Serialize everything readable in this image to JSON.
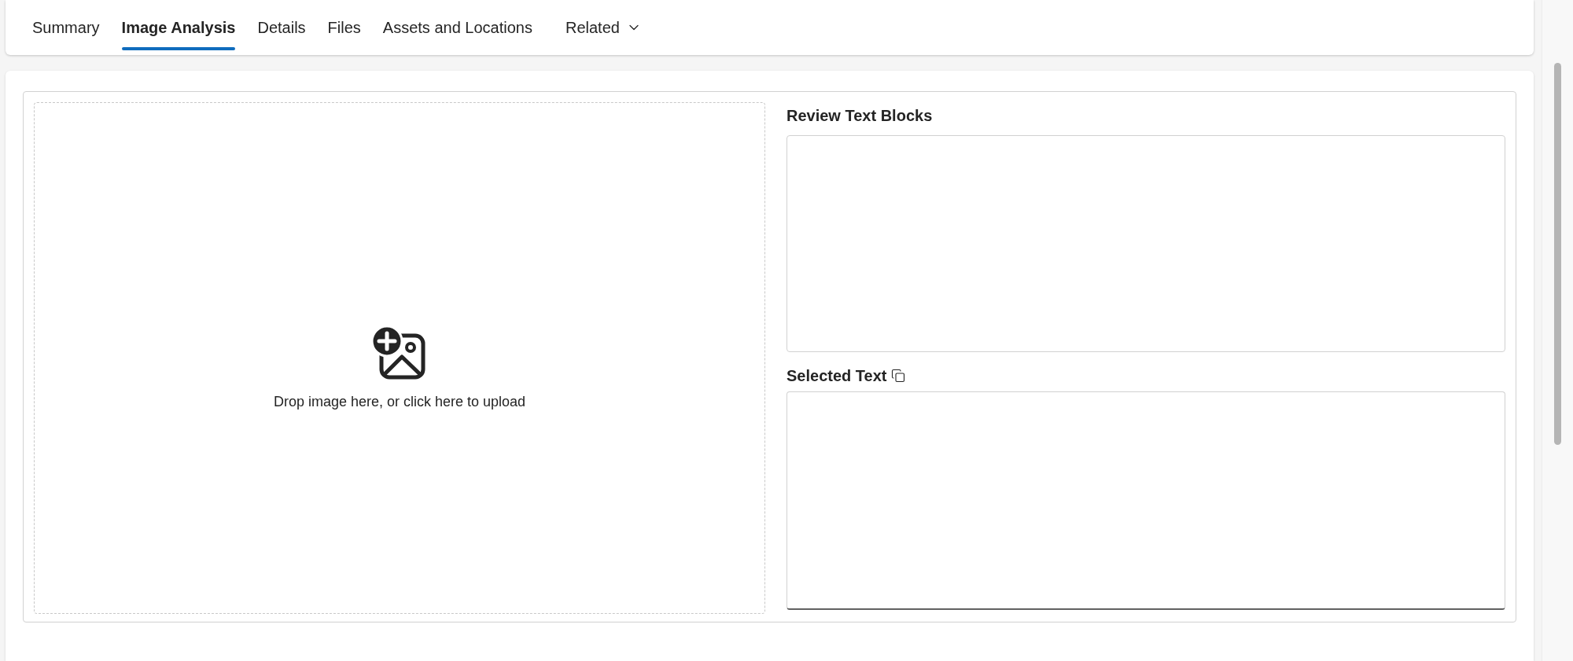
{
  "tabs": [
    {
      "label": "Summary",
      "selected": false,
      "kind": "tab"
    },
    {
      "label": "Image Analysis",
      "selected": true,
      "kind": "tab"
    },
    {
      "label": "Details",
      "selected": false,
      "kind": "tab"
    },
    {
      "label": "Files",
      "selected": false,
      "kind": "tab"
    },
    {
      "label": "Assets and Locations",
      "selected": false,
      "kind": "tab"
    },
    {
      "label": "Related",
      "selected": false,
      "kind": "menu"
    }
  ],
  "upload": {
    "prompt": "Drop image here, or click here to upload"
  },
  "review_text_blocks": {
    "label": "Review Text Blocks"
  },
  "selected_text": {
    "label": "Selected Text"
  }
}
